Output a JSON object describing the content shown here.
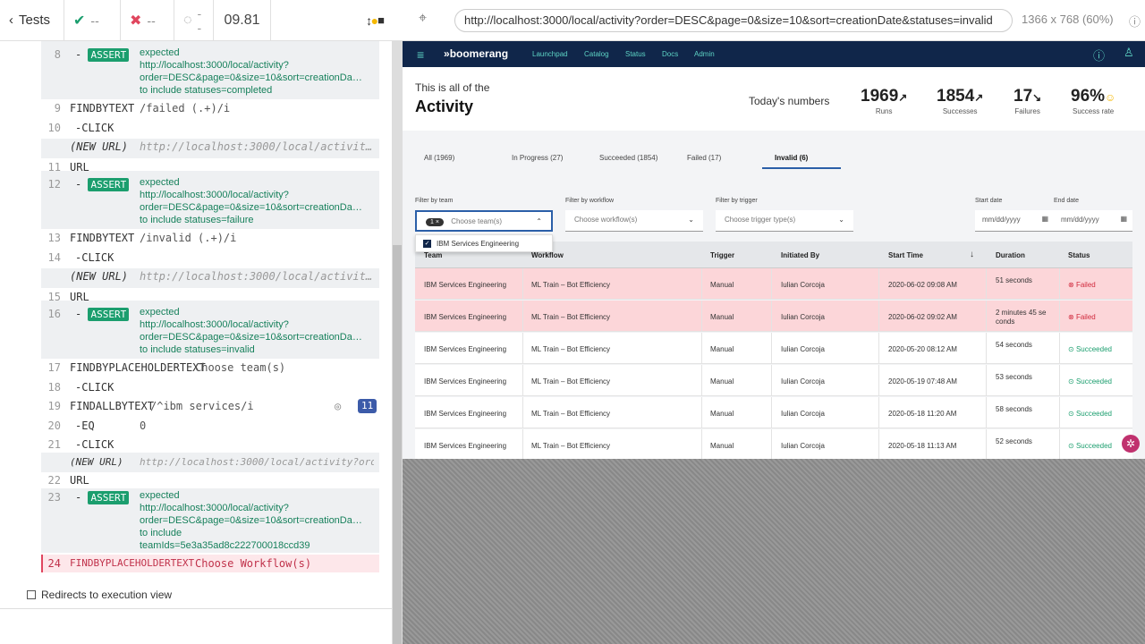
{
  "runner": {
    "tests_label": "Tests",
    "passed": "--",
    "failed": "--",
    "pending": "--",
    "duration": "09.81"
  },
  "commands": [
    {
      "num": "8",
      "name": "ASSERT",
      "badge": true,
      "lines": [
        "expected",
        "http://localhost:3000/local/activity?",
        "order=DESC&page=0&size=10&sort=creationDa…",
        "to include  statuses=completed"
      ]
    },
    {
      "num": "9",
      "name": "FINDBYTEXT",
      "arg": "/failed (.+)/i"
    },
    {
      "num": "10",
      "name": "-CLICK"
    },
    {
      "num": "",
      "name": "(NEW URL)",
      "arg": "http://localhost:3000/local/activit…"
    },
    {
      "num": "11",
      "name": "URL"
    },
    {
      "num": "12",
      "name": "ASSERT",
      "badge": true,
      "lines": [
        "expected",
        "http://localhost:3000/local/activity?",
        "order=DESC&page=0&size=10&sort=creationDa…",
        "to include  statuses=failure"
      ]
    },
    {
      "num": "13",
      "name": "FINDBYTEXT",
      "arg": "/invalid (.+)/i"
    },
    {
      "num": "14",
      "name": "-CLICK"
    },
    {
      "num": "",
      "name": "(NEW URL)",
      "arg": "http://localhost:3000/local/activit…"
    },
    {
      "num": "15",
      "name": "URL"
    },
    {
      "num": "16",
      "name": "ASSERT",
      "badge": true,
      "lines": [
        "expected",
        "http://localhost:3000/local/activity?",
        "order=DESC&page=0&size=10&sort=creationDa…",
        "to include  statuses=invalid"
      ]
    },
    {
      "num": "17",
      "name": "FINDBYPLACEHOLDERTEXT",
      "arg": "Choose team(s)"
    },
    {
      "num": "18",
      "name": "-CLICK"
    },
    {
      "num": "19",
      "name": "FINDALLBYTEXT",
      "arg": "/^ibm services/i",
      "count": "11"
    },
    {
      "num": "20",
      "name": "-EQ",
      "arg": "0"
    },
    {
      "num": "21",
      "name": "-CLICK"
    },
    {
      "num": "",
      "name": "(NEW URL)",
      "arg": "http://localhost:3000/local/activity?orde…"
    },
    {
      "num": "22",
      "name": "URL"
    },
    {
      "num": "23",
      "name": "ASSERT",
      "badge": true,
      "lines": [
        "expected",
        "http://localhost:3000/local/activity?",
        "order=DESC&page=0&size=10&sort=creationDa…",
        "to include",
        "teamIds=5e3a35ad8c222700018ccd39"
      ]
    },
    {
      "num": "24",
      "name": "FINDBYPLACEHOLDERTEXT",
      "arg": "Choose Workflow(s)"
    }
  ],
  "redirects_label": "Redirects to execution view",
  "browser": {
    "url": "http://localhost:3000/local/activity?order=DESC&page=0&size=10&sort=creationDate&statuses=invalid",
    "viewport": "1366 x 768  (60%)"
  },
  "app": {
    "brand": "boomerang",
    "nav": [
      "Launchpad",
      "Catalog",
      "Status",
      "Docs",
      "Admin"
    ],
    "subtitle": "This is all of the",
    "title": "Activity",
    "todays": "Today's numbers",
    "stats": [
      {
        "value": "1969",
        "arrow": "↗",
        "label": "Runs"
      },
      {
        "value": "1854",
        "arrow": "↗",
        "label": "Successes"
      },
      {
        "value": "17",
        "arrow": "↘",
        "label": "Failures"
      },
      {
        "value": "96%",
        "arrow": "☺",
        "label": "Success rate"
      }
    ],
    "tabs": [
      "All (1969)",
      "In Progress (27)",
      "Succeeded (1854)",
      "Failed (17)",
      "Invalid (6)"
    ],
    "filters": {
      "team_label": "Filter by team",
      "team_chip": "1",
      "team_placeholder": "Choose team(s)",
      "workflow_label": "Filter by workflow",
      "workflow_placeholder": "Choose workflow(s)",
      "trigger_label": "Filter by trigger",
      "trigger_placeholder": "Choose trigger type(s)",
      "start_label": "Start date",
      "end_label": "End date",
      "date_placeholder": "mm/dd/yyyy"
    },
    "dropdown_option": "IBM Services Engineering",
    "columns": [
      "Team",
      "Workflow",
      "Trigger",
      "Initiated By",
      "Start Time",
      "Duration",
      "Status"
    ],
    "rows": [
      {
        "team": "IBM Services Engineering",
        "workflow": "ML Train – Bot Efficiency",
        "trigger": "Manual",
        "by": "Iulian Corcoja",
        "start": "2020-06-02 09:08 AM",
        "duration": "51 seconds",
        "status": "Failed"
      },
      {
        "team": "IBM Services Engineering",
        "workflow": "ML Train – Bot Efficiency",
        "trigger": "Manual",
        "by": "Iulian Corcoja",
        "start": "2020-06-02 09:02 AM",
        "duration": "2 minutes 45 se conds",
        "status": "Failed"
      },
      {
        "team": "IBM Services Engineering",
        "workflow": "ML Train – Bot Efficiency",
        "trigger": "Manual",
        "by": "Iulian Corcoja",
        "start": "2020-05-20 08:12 AM",
        "duration": "54 seconds",
        "status": "Succeeded"
      },
      {
        "team": "IBM Services Engineering",
        "workflow": "ML Train – Bot Efficiency",
        "trigger": "Manual",
        "by": "Iulian Corcoja",
        "start": "2020-05-19 07:48 AM",
        "duration": "53 seconds",
        "status": "Succeeded"
      },
      {
        "team": "IBM Services Engineering",
        "workflow": "ML Train – Bot Efficiency",
        "trigger": "Manual",
        "by": "Iulian Corcoja",
        "start": "2020-05-18 11:20 AM",
        "duration": "58 seconds",
        "status": "Succeeded"
      },
      {
        "team": "IBM Services Engineering",
        "workflow": "ML Train – Bot Efficiency",
        "trigger": "Manual",
        "by": "Iulian Corcoja",
        "start": "2020-05-18 11:13 AM",
        "duration": "52 seconds",
        "status": "Succeeded"
      }
    ]
  }
}
